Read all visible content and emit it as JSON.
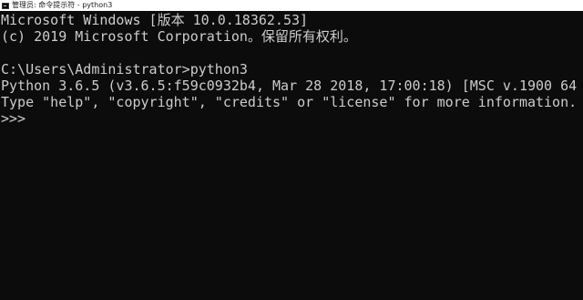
{
  "window": {
    "title": "管理员: 命令提示符 - python3",
    "icon": "cmd-icon"
  },
  "console": {
    "lines": [
      "Microsoft Windows [版本 10.0.18362.53]",
      "(c) 2019 Microsoft Corporation。保留所有权利。",
      "C:\\Users\\Administrator>python3",
      "Python 3.6.5 (v3.6.5:f59c0932b4, Mar 28 2018, 17:00:18) [MSC v.1900 64 bit",
      "Type \"help\", \"copyright\", \"credits\" or \"license\" for more information."
    ],
    "prompt": ">>>"
  },
  "colors": {
    "console_background": "#0c0c0c",
    "console_text": "#cccccc",
    "titlebar_background": "#ffffff"
  }
}
